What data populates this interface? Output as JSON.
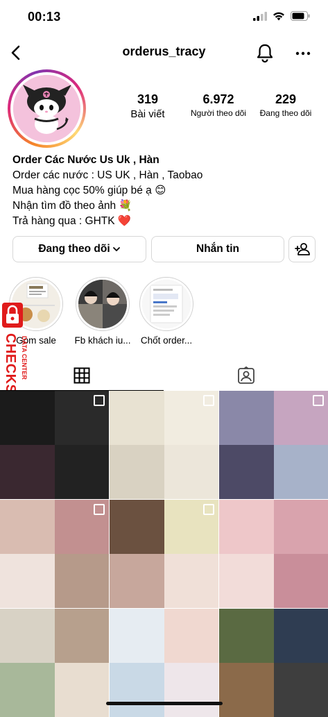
{
  "status": {
    "time": "00:13"
  },
  "header": {
    "username": "orderus_tracy"
  },
  "stats": {
    "posts": {
      "value": "319",
      "label": "Bài viết"
    },
    "followers": {
      "value": "6.972",
      "label": "Người theo dõi"
    },
    "following": {
      "value": "229",
      "label": "Đang theo dõi"
    }
  },
  "bio": {
    "name": "Order Các Nước Us Uk , Hàn",
    "lines": [
      "Order các nước : US UK , Hàn , Taobao",
      "Mua hàng cọc 50% giúp bé ạ 😊",
      "Nhận tìm đồ theo ảnh 💐",
      "Trả hàng qua : GHTK ❤️"
    ]
  },
  "buttons": {
    "following": "Đang theo dõi",
    "message": "Nhắn tin"
  },
  "highlights": [
    {
      "label": "Gom sale"
    },
    {
      "label": "Fb khách iu..."
    },
    {
      "label": "Chốt order..."
    }
  ],
  "watermark": {
    "main": "CHECKSCAM.INFO",
    "sub": "DATA CENTER"
  },
  "posts": [
    {
      "colors": [
        "#1b1b1b",
        "#2a2a2a",
        "#3a2830",
        "#222"
      ],
      "multi": true
    },
    {
      "colors": [
        "#e8e2d2",
        "#f1ece0",
        "#d9d2c2",
        "#ece6da"
      ],
      "multi": true
    },
    {
      "colors": [
        "#8a88a8",
        "#c6a5c0",
        "#4d4a66",
        "#a7b2c9"
      ],
      "multi": true
    },
    {
      "colors": [
        "#d9bcb1",
        "#c29090",
        "#efe3dd",
        "#b69a8a"
      ],
      "multi": true
    },
    {
      "colors": [
        "#6b5140",
        "#e8e3bf",
        "#c7a79c",
        "#f0e0d8"
      ],
      "multi": true
    },
    {
      "colors": [
        "#eec7c9",
        "#d9a3ad",
        "#f2dcd9",
        "#c98e9a"
      ],
      "multi": false
    },
    {
      "colors": [
        "#d8d2c5",
        "#b7a08d",
        "#a8b89a",
        "#e8ddd0"
      ],
      "multi": false
    },
    {
      "colors": [
        "#e6ecf2",
        "#f0d8d0",
        "#c9d9e6",
        "#eee6ea"
      ],
      "multi": false
    },
    {
      "colors": [
        "#5a6a42",
        "#2f3d52",
        "#8b6a4a",
        "#3e3e3e"
      ],
      "multi": false
    }
  ]
}
